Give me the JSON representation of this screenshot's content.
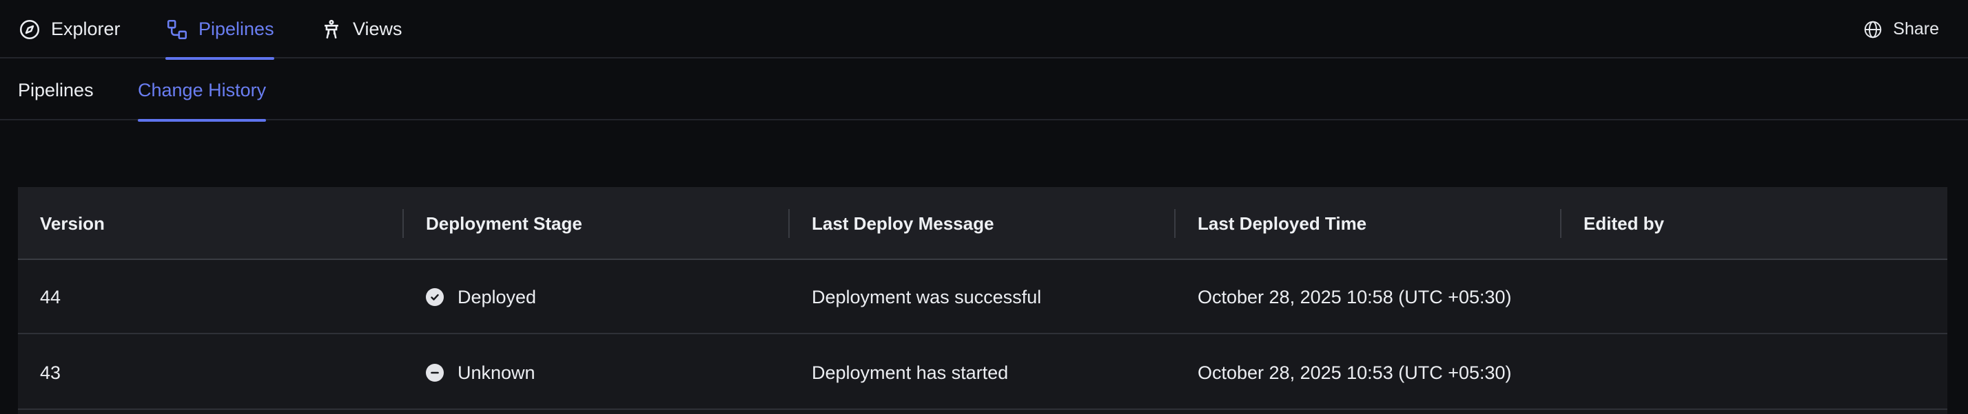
{
  "nav": {
    "tabs": [
      {
        "label": "Explorer",
        "icon": "compass-icon"
      },
      {
        "label": "Pipelines",
        "icon": "pipeline-icon",
        "active": true
      },
      {
        "label": "Views",
        "icon": "views-icon"
      }
    ],
    "share_label": "Share",
    "share_icon": "globe-icon"
  },
  "subnav": {
    "tabs": [
      {
        "label": "Pipelines"
      },
      {
        "label": "Change History",
        "active": true
      }
    ]
  },
  "table": {
    "columns": [
      "Version",
      "Deployment Stage",
      "Last Deploy Message",
      "Last Deployed Time",
      "Edited by"
    ],
    "rows": [
      {
        "version": "44",
        "stage": "Deployed",
        "stage_icon": "check-circle-icon",
        "message": "Deployment was successful",
        "time": "October 28, 2025 10:58 (UTC +05:30)",
        "edited_by": ""
      },
      {
        "version": "43",
        "stage": "Unknown",
        "stage_icon": "minus-circle-icon",
        "message": "Deployment has started",
        "time": "October 28, 2025 10:53 (UTC +05:30)",
        "edited_by": ""
      }
    ]
  },
  "colors": {
    "background": "#0c0d10",
    "accent": "#6a7ef2",
    "header_bg": "#1e1f24",
    "row_bg": "#17181c"
  }
}
